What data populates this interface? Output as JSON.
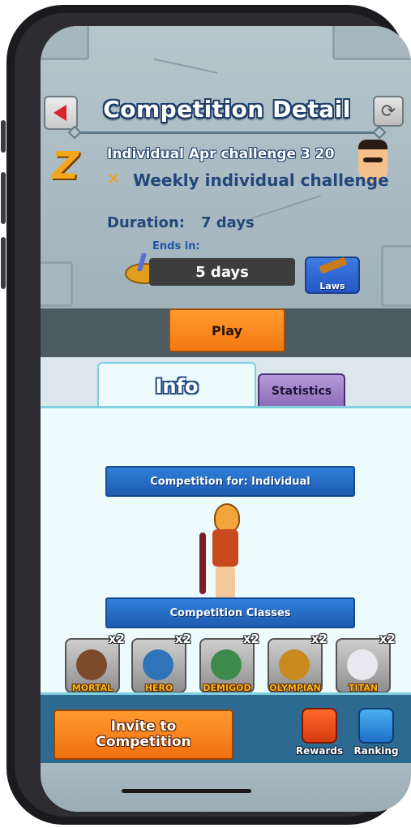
{
  "header": {
    "title": "Competition Detail"
  },
  "competition": {
    "name": "Individual Apr challenge 3 20",
    "type": "Weekly individual challenge",
    "duration_label": "Duration:",
    "duration_value": "7 days",
    "ends_label": "Ends in:",
    "ends_value": "5 days"
  },
  "buttons": {
    "laws": "Laws",
    "play": "Play",
    "invite_line1": "Invite to",
    "invite_line2": "Competition",
    "rewards": "Rewards",
    "ranking": "Ranking"
  },
  "tabs": {
    "info": "Info",
    "statistics": "Statistics"
  },
  "sections": {
    "competition_for": "Competition for: Individual",
    "competition_classes": "Competition Classes"
  },
  "classes": [
    {
      "name": "MORTAL",
      "multiplier": "x2",
      "color": "#7a4a2a"
    },
    {
      "name": "HERO",
      "multiplier": "x2",
      "color": "#2f74b8"
    },
    {
      "name": "DEMIGOD",
      "multiplier": "x2",
      "color": "#3d8b4a"
    },
    {
      "name": "OLYMPIAN",
      "multiplier": "x2",
      "color": "#c98a20"
    },
    {
      "name": "TITAN",
      "multiplier": "x2",
      "color": "#e8e8ee"
    }
  ],
  "colors": {
    "accent_orange": "#f27a12",
    "title_blue": "#23477a",
    "section_blue": "#1f5cb0",
    "tab_purple": "#8c6ab8"
  }
}
